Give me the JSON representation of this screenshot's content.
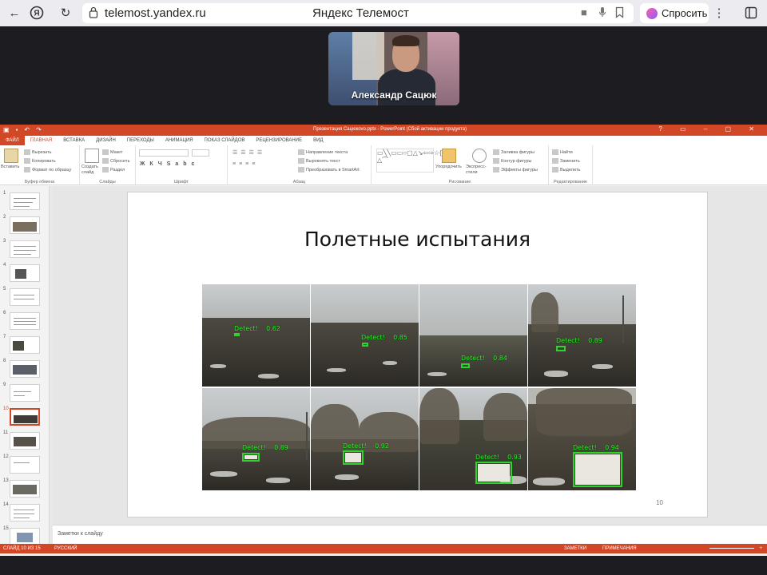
{
  "browser": {
    "url": "telemost.yandex.ru",
    "page_title": "Яндекс Телемост",
    "ask_label": "Спросить"
  },
  "video": {
    "participant_name": "Александр Сацюк"
  },
  "ppt": {
    "window_title": "Презентация Сацюкovo.pptx - PowerPoint (Сбой активации продукта)",
    "tabs": [
      "ФАЙЛ",
      "ГЛАВНАЯ",
      "ВСТАВКА",
      "ДИЗАЙН",
      "ПЕРЕХОДЫ",
      "АНИМАЦИЯ",
      "ПОКАЗ СЛАЙДОВ",
      "РЕЦЕНЗИРОВАНИЕ",
      "ВИД"
    ],
    "ribbon": {
      "paste": "Вставить",
      "cut": "Вырезать",
      "copy": "Копировать",
      "format_painter": "Формат по образцу",
      "clipboard_group": "Буфер обмена",
      "new_slide": "Создать слайд",
      "layout": "Макет",
      "reset": "Сбросить",
      "section": "Раздел",
      "slides_group": "Слайды",
      "font_group": "Шрифт",
      "text_direction": "Направление текста",
      "align_text": "Выровнять текст",
      "smartart": "Преобразовать в SmartArt",
      "paragraph_group": "Абзац",
      "arrange": "Упорядочить",
      "quick_styles": "Экспресс-стили",
      "shape_fill": "Заливка фигуры",
      "shape_outline": "Контур фигуры",
      "shape_effects": "Эффекты фигуры",
      "drawing_group": "Рисование",
      "find": "Найти",
      "replace": "Заменить",
      "select": "Выделить",
      "editing_group": "Редактирование"
    },
    "slide_title": "Полетные испытания",
    "slide_number": "10",
    "detections": [
      {
        "label": "Detect!",
        "score": "0.62"
      },
      {
        "label": "Detect!",
        "score": "0.85"
      },
      {
        "label": "Detect!",
        "score": "0.84"
      },
      {
        "label": "Detect!",
        "score": "0.89"
      },
      {
        "label": "Detect!",
        "score": "0.89"
      },
      {
        "label": "Detect!",
        "score": "0.92"
      },
      {
        "label": "Detect!",
        "score": "0.93"
      },
      {
        "label": "Detect!",
        "score": "0.94"
      }
    ],
    "thumbnails": [
      "1",
      "2",
      "3",
      "4",
      "5",
      "6",
      "7",
      "8",
      "9",
      "10",
      "11",
      "12",
      "13",
      "14",
      "15"
    ],
    "selected_slide": 10,
    "notes_placeholder": "Заметки к слайду",
    "status": {
      "slide_info": "СЛАЙД 10 ИЗ 15",
      "language": "РУССКИЙ",
      "notes": "ЗАМЕТКИ",
      "comments": "ПРИМЕЧАНИЯ",
      "zoom": "+"
    }
  }
}
